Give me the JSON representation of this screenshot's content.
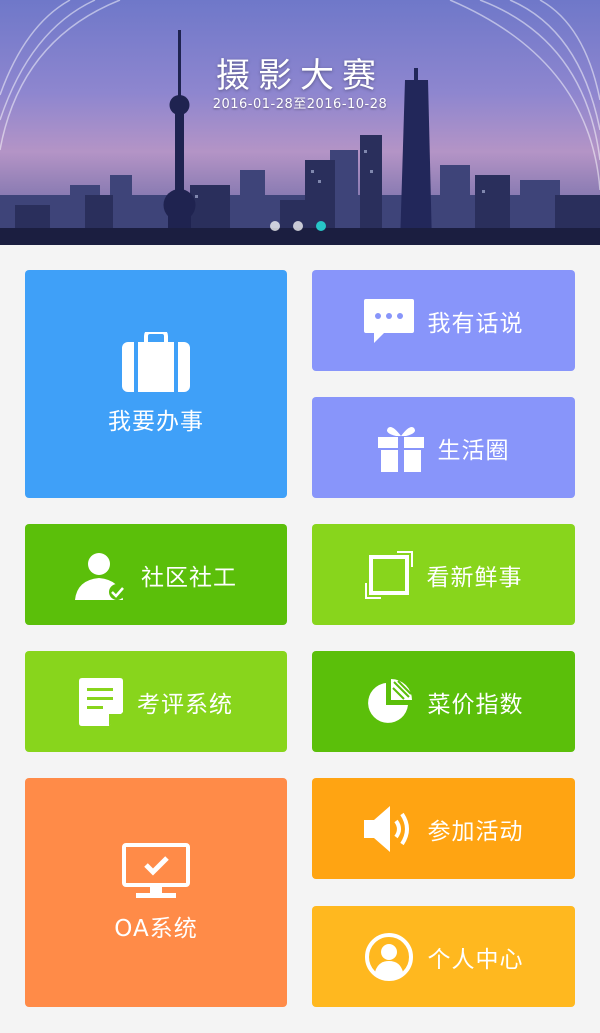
{
  "banner": {
    "title": "摄影大赛",
    "date_range": "2016-01-28至2016-10-28",
    "slides": 3,
    "active_slide": 3
  },
  "tiles": [
    {
      "id": "banshi",
      "label": "我要办事",
      "icon": "briefcase-icon",
      "color": "#3fa0f8"
    },
    {
      "id": "huashuo",
      "label": "我有话说",
      "icon": "chat-bubble-icon",
      "color": "#8895fa"
    },
    {
      "id": "shenghuo",
      "label": "生活圈",
      "icon": "gift-icon",
      "color": "#8895fa"
    },
    {
      "id": "shegong",
      "label": "社区社工",
      "icon": "user-check-icon",
      "color": "#5bbf0a"
    },
    {
      "id": "xinxianshi",
      "label": "看新鲜事",
      "icon": "expand-icon",
      "color": "#88d51c"
    },
    {
      "id": "kaoping",
      "label": "考评系统",
      "icon": "document-icon",
      "color": "#88d51c"
    },
    {
      "id": "caijia",
      "label": "菜价指数",
      "icon": "pie-chart-icon",
      "color": "#5bbf0a"
    },
    {
      "id": "oa",
      "label": "OA系统",
      "icon": "monitor-check-icon",
      "color": "#ff8b48"
    },
    {
      "id": "huodong",
      "label": "参加活动",
      "icon": "speaker-icon",
      "color": "#ffa412"
    },
    {
      "id": "geren",
      "label": "个人中心",
      "icon": "user-circle-icon",
      "color": "#ffb81f"
    }
  ]
}
